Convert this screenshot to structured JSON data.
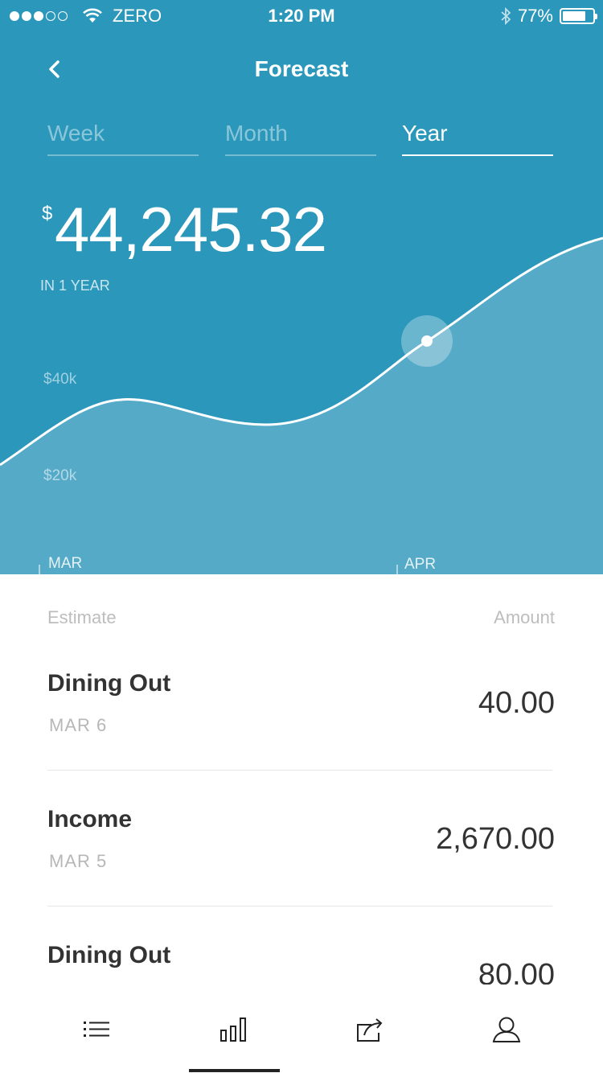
{
  "status_bar": {
    "carrier": "ZERO",
    "time": "1:20 PM",
    "battery": "77%",
    "battery_level": 0.77
  },
  "nav": {
    "title": "Forecast",
    "back_icon": "chevron-left-icon"
  },
  "tabs": [
    {
      "label": "Week",
      "active": false
    },
    {
      "label": "Month",
      "active": false
    },
    {
      "label": "Year",
      "active": true
    }
  ],
  "balance": {
    "currency_symbol": "$",
    "amount": "44,245.32",
    "caption": "IN 1 YEAR"
  },
  "chart_data": {
    "type": "area",
    "y_tick_labels": [
      "$40k",
      "$20k"
    ],
    "x_tick_labels": [
      "MAR",
      "APR"
    ],
    "colors": {
      "background": "#2b97bb",
      "area": "#55aac8",
      "line": "#ffffff"
    }
  },
  "list": {
    "header": {
      "estimate": "Estimate",
      "amount": "Amount"
    },
    "items": [
      {
        "title": "Dining Out",
        "date": "MAR 6",
        "amount": "40.00"
      },
      {
        "title": "Income",
        "date": "MAR 5",
        "amount": "2,670.00"
      },
      {
        "title": "Dining Out",
        "date": "",
        "amount": "80.00"
      }
    ]
  },
  "tab_bar": {
    "items": [
      "list-icon",
      "bar-chart-icon",
      "share-icon",
      "profile-icon"
    ],
    "active": "bar-chart-icon"
  }
}
